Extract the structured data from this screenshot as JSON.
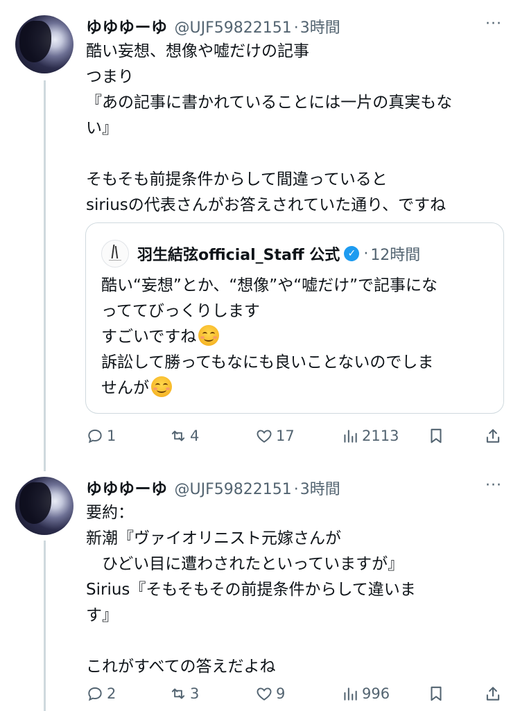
{
  "tweets": [
    {
      "name": "ゆゆゆーゆ",
      "handle": "@UJF59822151",
      "dot": "·",
      "time": "3時間",
      "more": "···",
      "lines": [
        "酷い妄想、想像や嘘だけの記事",
        "つまり",
        "『あの記事に書かれていることには一片の真実もな",
        "い』",
        "",
        "そもそも前提条件からして間違っていると",
        "siriusの代表さんがお答えされていた通り、ですね"
      ],
      "quote": {
        "name": "羽生結弦official_Staff 公式",
        "verified_mark": "✓",
        "dot": "·",
        "time": "12時間",
        "lines": [
          "酷い“妄想”とか、“想像”や“嘘だけ”で記事にな",
          "っててびっくりします",
          "すごいですね",
          "訴訟して勝ってもなにも良いことないのでしま",
          "せんが"
        ]
      },
      "actions": {
        "replies": "1",
        "retweets": "4",
        "likes": "17",
        "views": "2113"
      }
    },
    {
      "name": "ゆゆゆーゆ",
      "handle": "@UJF59822151",
      "dot": "·",
      "time": "3時間",
      "more": "···",
      "lines": [
        "要約：",
        "新潮『ヴァイオリニスト元嫁さんが",
        "　ひどい目に遭わされたといっていますが』",
        "Sirius『そもそもその前提条件からして違いま",
        "す』",
        "",
        "これがすべての答えだよね"
      ],
      "actions": {
        "replies": "2",
        "retweets": "3",
        "likes": "9",
        "views": "996"
      }
    }
  ],
  "icons": {
    "reply": "reply-icon",
    "retweet": "retweet-icon",
    "like": "heart-icon",
    "views": "views-icon",
    "bookmark": "bookmark-icon",
    "share": "share-icon"
  },
  "colors": {
    "text": "#0f1419",
    "secondary": "#536471",
    "border": "#cfd9de",
    "verified": "#1d9bf0"
  }
}
